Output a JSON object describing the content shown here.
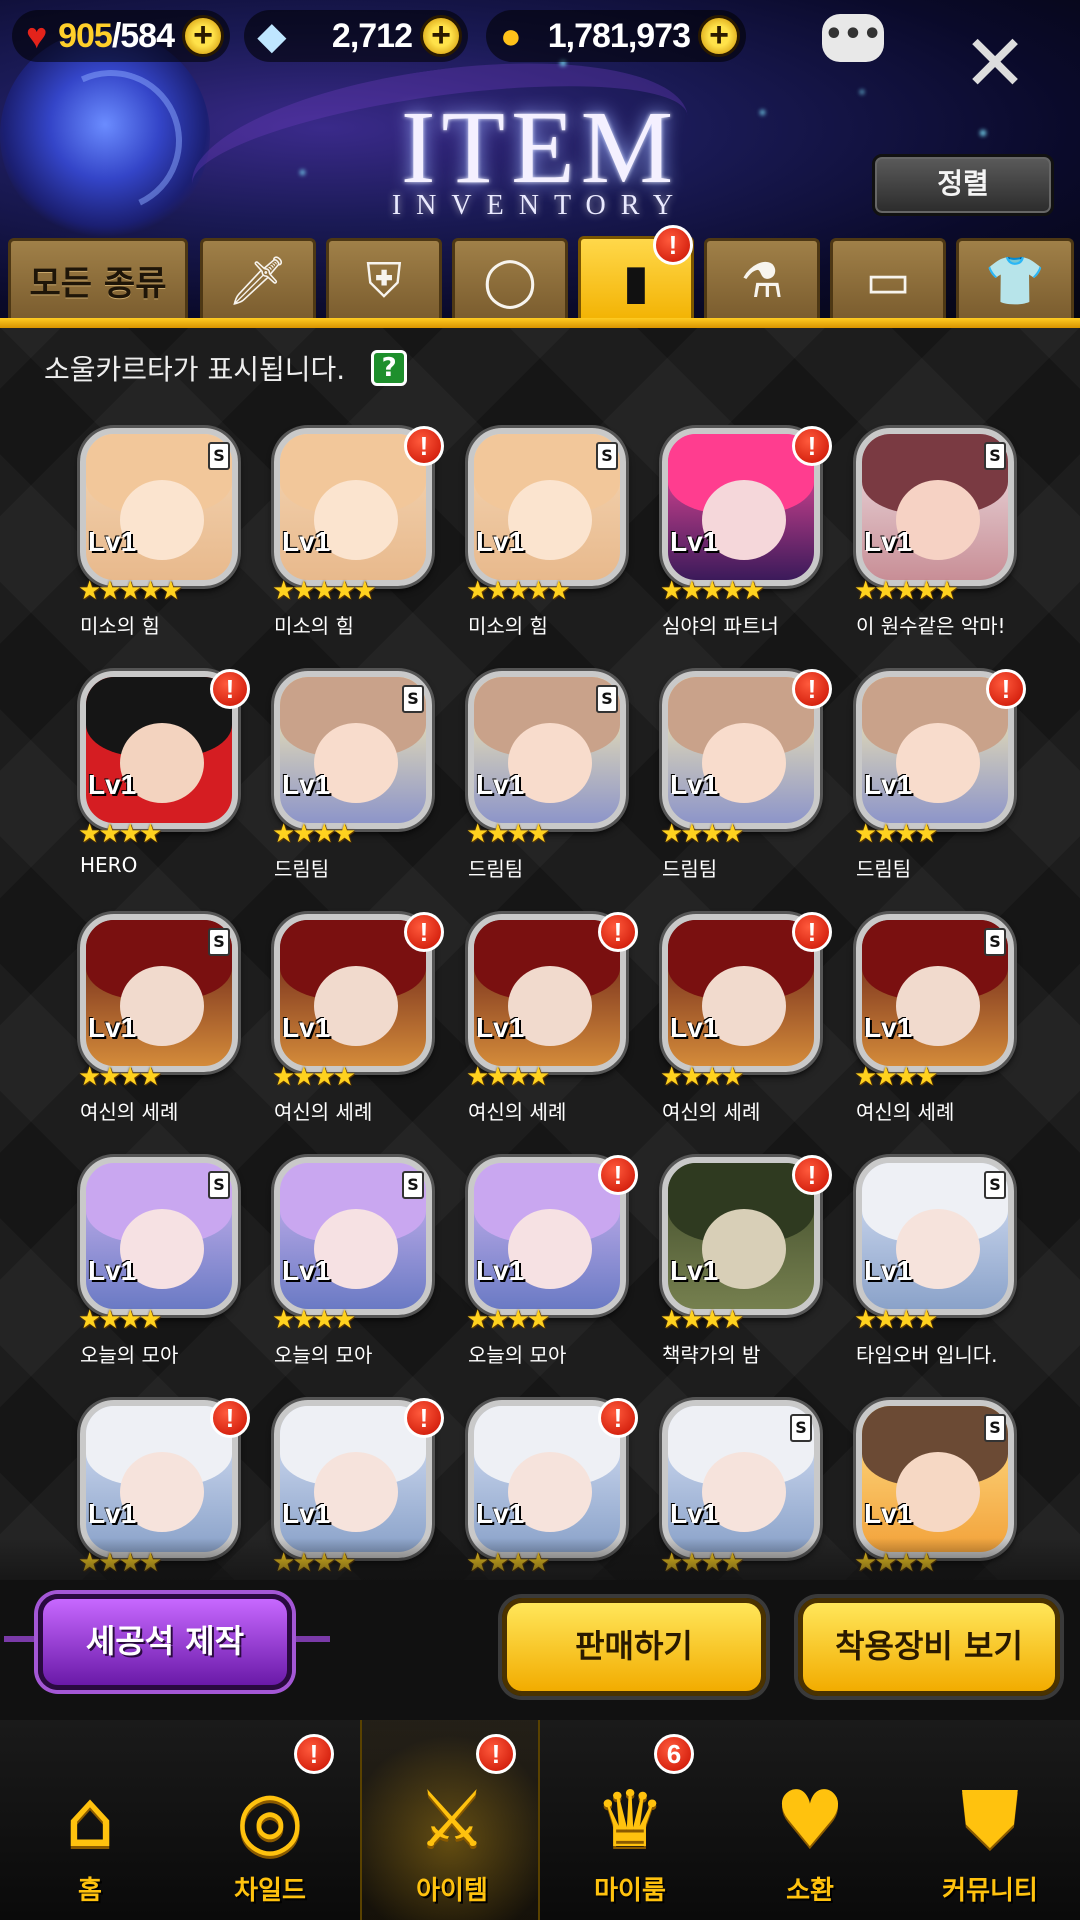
{
  "resources": {
    "hp_current": "905",
    "hp_max": "/584",
    "gems": "2,712",
    "gold": "1,781,973",
    "plus": "+"
  },
  "header": {
    "title": "ITEM",
    "subtitle": "INVENTORY",
    "sort_label": "정렬",
    "chat_icon": "•••",
    "close_icon": "✕"
  },
  "tabs": [
    {
      "label": "모든 종류",
      "icon": "all-types"
    },
    {
      "label": "",
      "icon": "sword-icon"
    },
    {
      "label": "",
      "icon": "shield-icon"
    },
    {
      "label": "",
      "icon": "ring-icon"
    },
    {
      "label": "",
      "icon": "soul-card-icon",
      "active": true,
      "badge": "!"
    },
    {
      "label": "",
      "icon": "flask-icon"
    },
    {
      "label": "",
      "icon": "card-icon"
    },
    {
      "label": "",
      "icon": "costume-icon"
    }
  ],
  "info_text": "소울카르타가 표시됩니다.",
  "help_label": "?",
  "badge_mark": "!",
  "level_label": "Lv1",
  "cards": [
    {
      "name": "미소의 힘",
      "stars": "★★★★★",
      "badge": false
    },
    {
      "name": "미소의 힘",
      "stars": "★★★★★",
      "badge": true
    },
    {
      "name": "미소의 힘",
      "stars": "★★★★★",
      "badge": false
    },
    {
      "name": "심야의 파트너",
      "stars": "★★★★★",
      "badge": true
    },
    {
      "name": "이 원수같은 악마!",
      "stars": "★★★★★",
      "badge": false
    },
    {
      "name": "HERO",
      "stars": "★★★★",
      "badge": true
    },
    {
      "name": "드림팀",
      "stars": "★★★★",
      "badge": false
    },
    {
      "name": "드림팀",
      "stars": "★★★★",
      "badge": false
    },
    {
      "name": "드림팀",
      "stars": "★★★★",
      "badge": true
    },
    {
      "name": "드림팀",
      "stars": "★★★★",
      "badge": true
    },
    {
      "name": "여신의 세례",
      "stars": "★★★★",
      "badge": false
    },
    {
      "name": "여신의 세례",
      "stars": "★★★★",
      "badge": true
    },
    {
      "name": "여신의 세례",
      "stars": "★★★★",
      "badge": true
    },
    {
      "name": "여신의 세례",
      "stars": "★★★★",
      "badge": true
    },
    {
      "name": "여신의 세례",
      "stars": "★★★★",
      "badge": false
    },
    {
      "name": "오늘의 모아",
      "stars": "★★★★",
      "badge": false
    },
    {
      "name": "오늘의 모아",
      "stars": "★★★★",
      "badge": false
    },
    {
      "name": "오늘의 모아",
      "stars": "★★★★",
      "badge": true
    },
    {
      "name": "책략가의 밤",
      "stars": "★★★★",
      "badge": true
    },
    {
      "name": "타임오버 입니다.",
      "stars": "★★★★",
      "badge": false
    },
    {
      "name": "",
      "stars": "★★★★",
      "badge": true
    },
    {
      "name": "",
      "stars": "★★★★",
      "badge": true
    },
    {
      "name": "",
      "stars": "★★★★",
      "badge": true
    },
    {
      "name": "",
      "stars": "★★★★",
      "badge": false
    },
    {
      "name": "",
      "stars": "★★★★",
      "badge": false
    }
  ],
  "actions": {
    "craft": "세공석 제작",
    "sell": "판매하기",
    "equipped": "착용장비 보기"
  },
  "nav": [
    {
      "label": "홈",
      "icon": "home-icon",
      "badge": ""
    },
    {
      "label": "차일드",
      "icon": "child-flame-icon",
      "badge": "!"
    },
    {
      "label": "아이템",
      "icon": "item-sword-shield-icon",
      "badge": "!",
      "active": true
    },
    {
      "label": "마이룸",
      "icon": "myroom-crown-icon",
      "badge": "6"
    },
    {
      "label": "소환",
      "icon": "summon-bottle-icon",
      "badge": ""
    },
    {
      "label": "커뮤니티",
      "icon": "community-shield-icon",
      "badge": ""
    }
  ]
}
